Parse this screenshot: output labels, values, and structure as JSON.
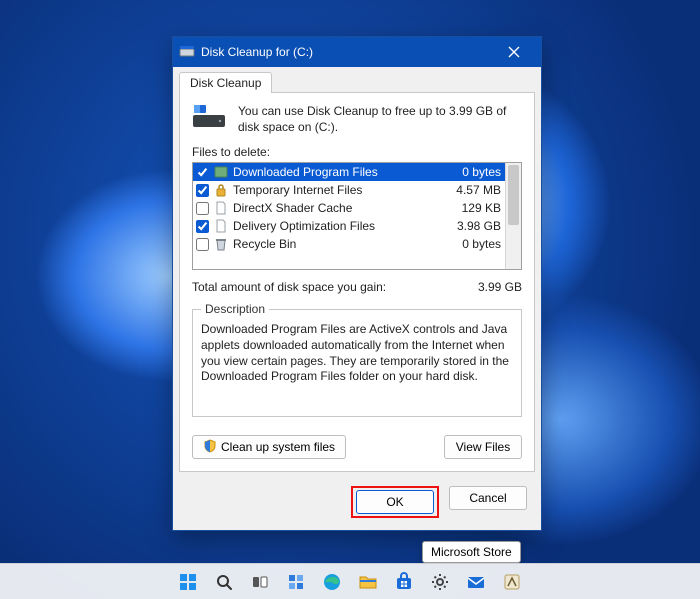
{
  "window": {
    "title": "Disk Cleanup for  (C:)",
    "tab": "Disk Cleanup",
    "intro": "You can use Disk Cleanup to free up to 3.99 GB of disk space on  (C:).",
    "files_to_delete_label": "Files to delete:",
    "total_label": "Total amount of disk space you gain:",
    "total_value": "3.99 GB",
    "description_legend": "Description",
    "description_text": "Downloaded Program Files are ActiveX controls and Java applets downloaded automatically from the Internet when you view certain pages. They are temporarily stored in the Downloaded Program Files folder on your hard disk.",
    "cleanup_sys_label": "Clean up system files",
    "view_files_label": "View Files",
    "ok_label": "OK",
    "cancel_label": "Cancel"
  },
  "files": [
    {
      "name": "Downloaded Program Files",
      "size": "0 bytes",
      "checked": true,
      "selected": true
    },
    {
      "name": "Temporary Internet Files",
      "size": "4.57 MB",
      "checked": true,
      "selected": false
    },
    {
      "name": "DirectX Shader Cache",
      "size": "129 KB",
      "checked": false,
      "selected": false
    },
    {
      "name": "Delivery Optimization Files",
      "size": "3.98 GB",
      "checked": true,
      "selected": false
    },
    {
      "name": "Recycle Bin",
      "size": "0 bytes",
      "checked": false,
      "selected": false
    }
  ],
  "tooltip": {
    "text": "Microsoft Store"
  },
  "taskbar_items": [
    "start-icon",
    "search-icon",
    "task-view-icon",
    "widgets-icon",
    "edge-icon",
    "file-explorer-icon",
    "store-icon",
    "settings-icon",
    "mail-icon",
    "app-icon"
  ]
}
